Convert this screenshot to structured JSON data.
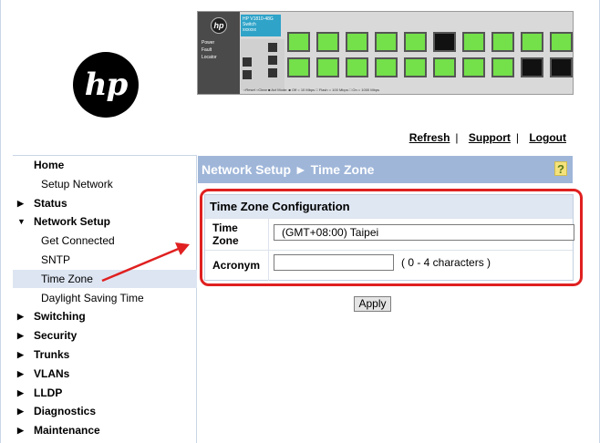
{
  "logo": {
    "text": "hp"
  },
  "device": {
    "badge": "hp",
    "model": [
      "HP V1810-48G",
      "Switch",
      "xxxxxx"
    ],
    "leds": [
      "Power",
      "Fault",
      "Locator"
    ],
    "footer": "○Reset ○Clear  ■ Act Mode: ■ Off = 10 Mbps  □ Flash = 100 Mbps  □ On = 1000 Mbps"
  },
  "top_links": {
    "refresh": "Refresh",
    "support": "Support",
    "logout": "Logout",
    "separator": "|"
  },
  "sidebar": {
    "items": [
      {
        "label": "Home",
        "level": "top",
        "arrow": ""
      },
      {
        "label": "Setup Network",
        "level": "sub",
        "arrow": ""
      },
      {
        "label": "Status",
        "level": "top",
        "arrow": "▶"
      },
      {
        "label": "Network Setup",
        "level": "top",
        "arrow": "▼"
      },
      {
        "label": "Get Connected",
        "level": "sub",
        "arrow": ""
      },
      {
        "label": "SNTP",
        "level": "sub",
        "arrow": ""
      },
      {
        "label": "Time Zone",
        "level": "sub",
        "arrow": "",
        "selected": true
      },
      {
        "label": "Daylight Saving Time",
        "level": "sub",
        "arrow": ""
      },
      {
        "label": "Switching",
        "level": "top",
        "arrow": "▶"
      },
      {
        "label": "Security",
        "level": "top",
        "arrow": "▶"
      },
      {
        "label": "Trunks",
        "level": "top",
        "arrow": "▶"
      },
      {
        "label": "VLANs",
        "level": "top",
        "arrow": "▶"
      },
      {
        "label": "LLDP",
        "level": "top",
        "arrow": "▶"
      },
      {
        "label": "Diagnostics",
        "level": "top",
        "arrow": "▶"
      },
      {
        "label": "Maintenance",
        "level": "top",
        "arrow": "▶"
      }
    ]
  },
  "banner": {
    "title": "Network Setup ► Time Zone",
    "help": "?"
  },
  "config": {
    "title": "Time Zone Configuration",
    "time_zone_label_1": "Time",
    "time_zone_label_2": "Zone",
    "time_zone_value": "(GMT+08:00) Taipei",
    "acronym_label": "Acronym",
    "acronym_value": "",
    "acronym_hint": "( 0 - 4 characters )"
  },
  "apply_label": "Apply",
  "colors": {
    "banner": "#9fb6d9",
    "highlight": "#e02020",
    "port_green": "#74e04a"
  }
}
